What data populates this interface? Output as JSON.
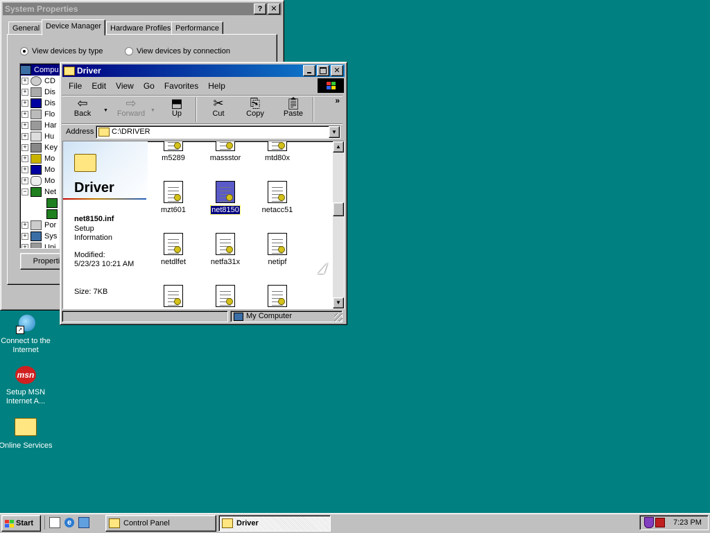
{
  "system_properties": {
    "title": "System Properties",
    "help_btn": "?",
    "close_btn": "✕",
    "tabs": [
      "General",
      "Device Manager",
      "Hardware Profiles",
      "Performance"
    ],
    "radio_by_type": "View devices by type",
    "radio_by_connection": "View devices by connection",
    "tree": [
      "Compu",
      "CD",
      "Dis",
      "Dis",
      "Flo",
      "Har",
      "Hu",
      "Key",
      "Mo",
      "Mo",
      "Mo",
      "Net",
      "",
      "",
      "Por",
      "Sys",
      "Uni"
    ],
    "properties_btn": "Propertie"
  },
  "driver_window": {
    "title": "Driver",
    "menu": [
      "File",
      "Edit",
      "View",
      "Go",
      "Favorites",
      "Help"
    ],
    "toolbar": {
      "back": "Back",
      "forward": "Forward",
      "up": "Up",
      "cut": "Cut",
      "copy": "Copy",
      "paste": "Paste",
      "more": "»"
    },
    "address_label": "Address",
    "address_value": "C:\\DRIVER",
    "side_panel": {
      "folder_title": "Driver",
      "file_name": "net8150.inf",
      "file_type": "Setup Information",
      "modified_label": "Modified:",
      "modified_value": "5/23/23 10:21 AM",
      "size": "Size: 7KB"
    },
    "files": [
      "m5289",
      "massstor",
      "mtd80x",
      "mzt601",
      "net8150",
      "netacc51",
      "netdlfet",
      "netfa31x",
      "netipf"
    ],
    "selected_file": "net8150",
    "status_text": "My Computer"
  },
  "desktop_icons": [
    {
      "label": "Connect to the Internet",
      "icon": "connect-internet-icon"
    },
    {
      "label": "Setup MSN Internet A...",
      "icon": "msn-icon"
    },
    {
      "label": "Online Services",
      "icon": "folder-icon"
    }
  ],
  "taskbar": {
    "start_label": "Start",
    "tasks": [
      "Control Panel",
      "Driver"
    ],
    "active_task": "Driver",
    "clock": "7:23 PM"
  }
}
